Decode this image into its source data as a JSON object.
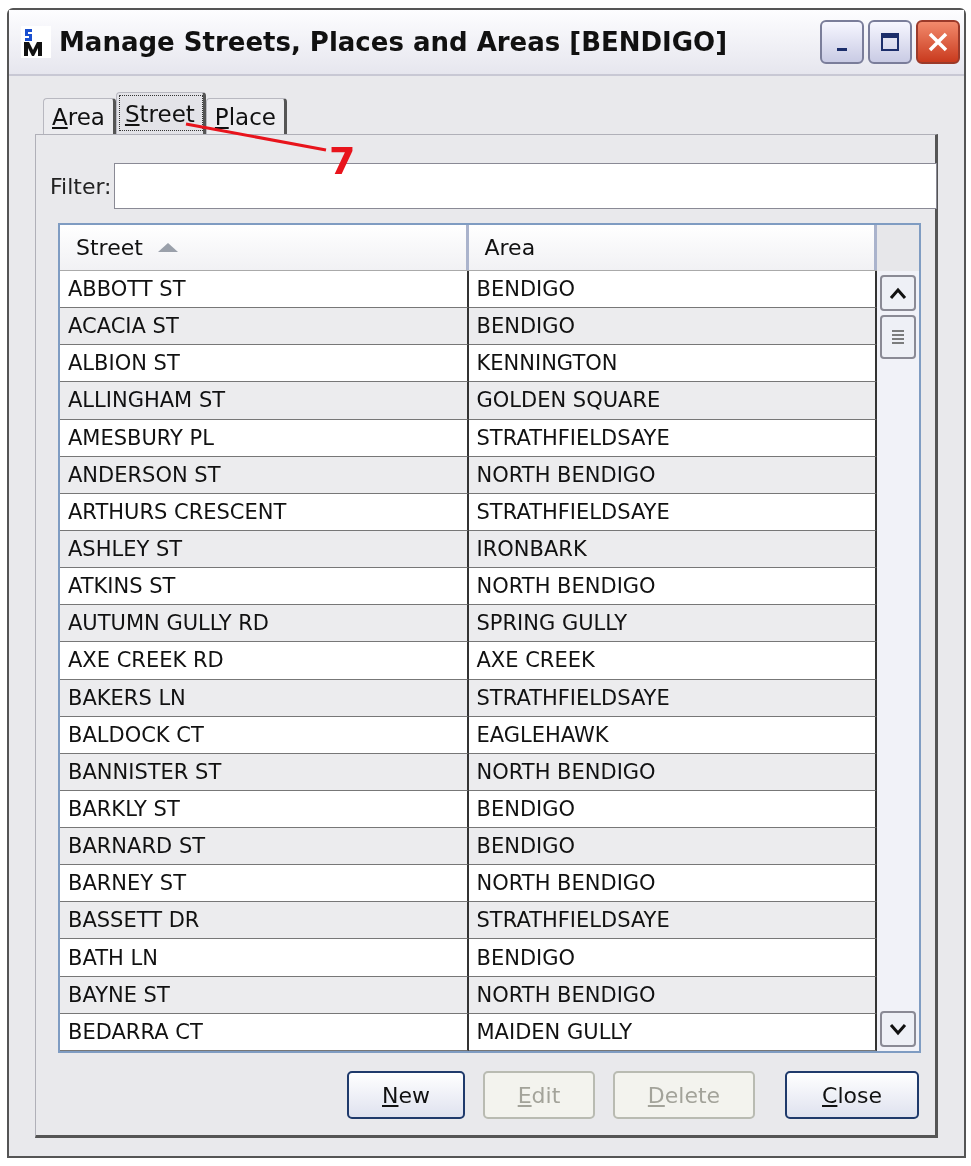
{
  "window": {
    "title": "Manage Streets, Places and Areas [BENDIGO]"
  },
  "tabs": [
    {
      "label": "Area",
      "selected": false
    },
    {
      "label": "Street",
      "selected": true
    },
    {
      "label": "Place",
      "selected": false
    }
  ],
  "annotation": {
    "label": "7"
  },
  "filter": {
    "label": "Filter:"
  },
  "table": {
    "columns": [
      {
        "label": "Street",
        "sorted": true
      },
      {
        "label": "Area",
        "sorted": false
      }
    ],
    "rows": [
      [
        "ABBOTT ST",
        "BENDIGO"
      ],
      [
        "ACACIA ST",
        "BENDIGO"
      ],
      [
        "ALBION ST",
        "KENNINGTON"
      ],
      [
        "ALLINGHAM ST",
        "GOLDEN SQUARE"
      ],
      [
        "AMESBURY PL",
        "STRATHFIELDSAYE"
      ],
      [
        "ANDERSON ST",
        "NORTH BENDIGO"
      ],
      [
        "ARTHURS CRESCENT",
        "STRATHFIELDSAYE"
      ],
      [
        "ASHLEY ST",
        "IRONBARK"
      ],
      [
        "ATKINS ST",
        "NORTH BENDIGO"
      ],
      [
        "AUTUMN GULLY RD",
        "SPRING GULLY"
      ],
      [
        "AXE CREEK RD",
        "AXE CREEK"
      ],
      [
        "BAKERS LN",
        "STRATHFIELDSAYE"
      ],
      [
        "BALDOCK CT",
        "EAGLEHAWK"
      ],
      [
        "BANNISTER ST",
        "NORTH BENDIGO"
      ],
      [
        "BARKLY ST",
        "BENDIGO"
      ],
      [
        "BARNARD ST",
        "BENDIGO"
      ],
      [
        "BARNEY ST",
        "NORTH BENDIGO"
      ],
      [
        "BASSETT DR",
        "STRATHFIELDSAYE"
      ],
      [
        "BATH LN",
        "BENDIGO"
      ],
      [
        "BAYNE ST",
        "NORTH BENDIGO"
      ],
      [
        "BEDARRA CT",
        "MAIDEN GULLY"
      ]
    ]
  },
  "buttons": [
    {
      "label": "New",
      "disabled": false
    },
    {
      "label": "Edit",
      "disabled": true
    },
    {
      "label": "Delete",
      "disabled": true
    },
    {
      "label": "Close",
      "disabled": false
    }
  ]
}
